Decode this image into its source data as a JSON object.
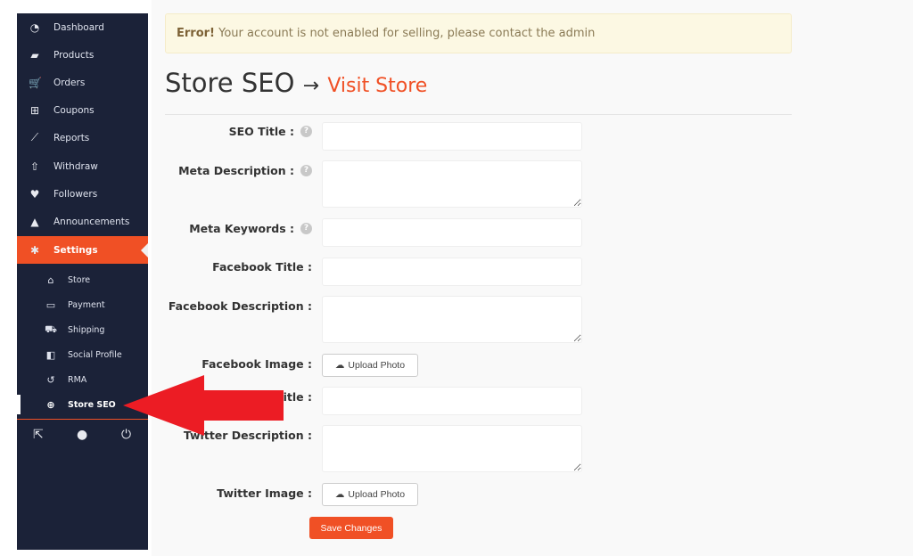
{
  "sidebar": {
    "items": [
      {
        "label": "Dashboard",
        "icon": "dashboard-icon",
        "glyph": "◔"
      },
      {
        "label": "Products",
        "icon": "briefcase-icon",
        "glyph": "▰"
      },
      {
        "label": "Orders",
        "icon": "cart-icon",
        "glyph": "🛒"
      },
      {
        "label": "Coupons",
        "icon": "gift-icon",
        "glyph": "⊞"
      },
      {
        "label": "Reports",
        "icon": "chart-line-icon",
        "glyph": "⟋"
      },
      {
        "label": "Withdraw",
        "icon": "upload-icon",
        "glyph": "⇧"
      },
      {
        "label": "Followers",
        "icon": "heart-icon",
        "glyph": "♥"
      },
      {
        "label": "Announcements",
        "icon": "bell-icon",
        "glyph": "▲"
      },
      {
        "label": "Settings",
        "icon": "gear-icon",
        "glyph": "✱"
      }
    ],
    "sub_items": [
      {
        "label": "Store",
        "icon": "bank-icon",
        "glyph": "⌂"
      },
      {
        "label": "Payment",
        "icon": "credit-card-icon",
        "glyph": "▭"
      },
      {
        "label": "Shipping",
        "icon": "truck-icon",
        "glyph": "⛟"
      },
      {
        "label": "Social Profile",
        "icon": "share-icon",
        "glyph": "◧"
      },
      {
        "label": "RMA",
        "icon": "undo-icon",
        "glyph": "↺"
      },
      {
        "label": "Store SEO",
        "icon": "globe-icon",
        "glyph": "⊕"
      }
    ],
    "footer": [
      {
        "icon": "external-link-icon",
        "glyph": "⇱"
      },
      {
        "icon": "user-icon",
        "glyph": "●"
      },
      {
        "icon": "power-icon",
        "glyph": "⏻"
      }
    ]
  },
  "alert": {
    "strong": "Error!",
    "text": " Your account is not enabled for selling, please contact the admin"
  },
  "page": {
    "title": "Store SEO",
    "arrow": "→",
    "link": "Visit Store"
  },
  "form": {
    "fields": [
      {
        "label": "SEO Title :",
        "help": "?"
      },
      {
        "label": "Meta Description :",
        "help": "?"
      },
      {
        "label": "Meta Keywords :",
        "help": "?"
      },
      {
        "label": "Facebook Title :"
      },
      {
        "label": "Facebook Description :"
      },
      {
        "label": "Facebook Image :"
      },
      {
        "label": "Twitter Title :"
      },
      {
        "label": "Twitter Description :"
      },
      {
        "label": "Twitter Image :"
      }
    ],
    "upload_label": "Upload Photo",
    "save_label": "Save Changes"
  },
  "colors": {
    "accent": "#f05025",
    "sidebar": "#1b2238",
    "annotation_arrow": "#ec1c24"
  }
}
